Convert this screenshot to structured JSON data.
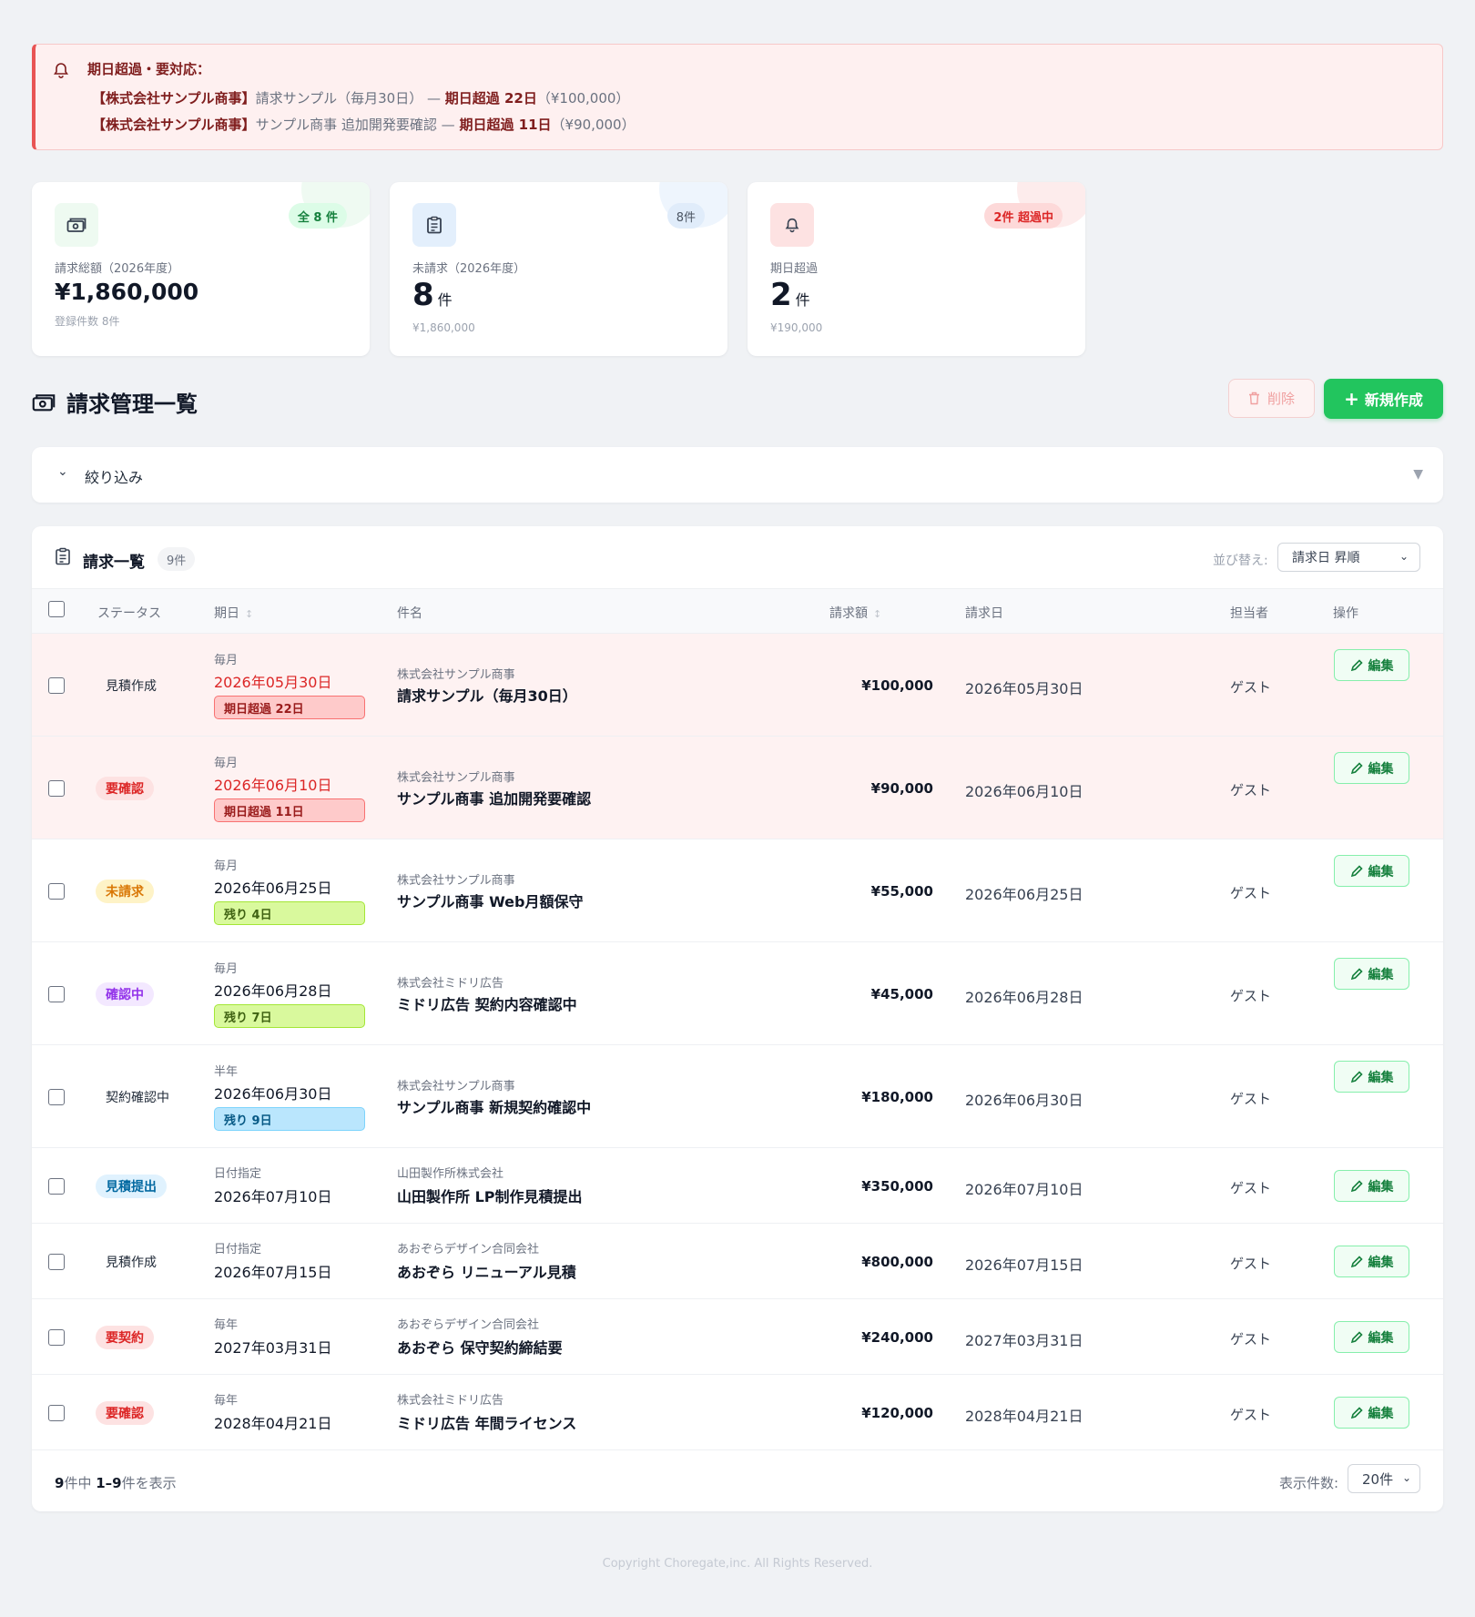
{
  "alert": {
    "title": "期日超過・要対応：",
    "items": [
      {
        "company": "【株式会社サンプル商事】",
        "subject": "請求サンプル（毎月30日）",
        "sep": " — ",
        "overdue": "期日超過 22日",
        "amount": "（¥100,000）"
      },
      {
        "company": "【株式会社サンプル商事】",
        "subject": "サンプル商事 追加開発要確認",
        "sep": " — ",
        "overdue": "期日超過 11日",
        "amount": "（¥90,000）"
      }
    ]
  },
  "cards": [
    {
      "badge": "全 8 件",
      "label": "請求総額（2026年度）",
      "value": "¥1,860,000",
      "unit": "",
      "sub": "登録件数 8件",
      "accent": "#22c55e",
      "icon": "money-icon"
    },
    {
      "badge": "8件",
      "label": "未請求（2026年度）",
      "value": "8",
      "unit": "件",
      "sub": "¥1,860,000",
      "accent": "#3b82f6",
      "icon": "clipboard-icon"
    },
    {
      "badge": "2件 超過中",
      "label": "期日超過",
      "value": "2",
      "unit": "件",
      "sub": "¥190,000",
      "accent": "#ef4444",
      "icon": "bell-icon"
    }
  ],
  "page": {
    "title": "請求管理一覧",
    "delete_label": "削除",
    "new_label": "新規作成"
  },
  "filter": {
    "label": "絞り込み"
  },
  "list": {
    "title": "請求一覧",
    "count": "9件",
    "sort_label": "並び替え:",
    "sort_value": "請求日 昇順",
    "columns": {
      "status": "ステータス",
      "due": "期日",
      "subject": "件名",
      "amount": "請求額",
      "billing_date": "請求日",
      "owner": "担当者",
      "actions": "操作"
    },
    "edit_label": "編集",
    "rows": [
      {
        "status": "見積作成",
        "cycle": "毎月",
        "due": "2026年05月30日",
        "chip": "期日超過 22日",
        "company": "株式会社サンプル商事",
        "subject": "請求サンプル（毎月30日）",
        "amount": "¥100,000",
        "billing_date": "2026年05月30日",
        "owner": "ゲスト"
      },
      {
        "status": "要確認",
        "cycle": "毎月",
        "due": "2026年06月10日",
        "chip": "期日超過 11日",
        "company": "株式会社サンプル商事",
        "subject": "サンプル商事 追加開発要確認",
        "amount": "¥90,000",
        "billing_date": "2026年06月10日",
        "owner": "ゲスト"
      },
      {
        "status": "未請求",
        "cycle": "毎月",
        "due": "2026年06月25日",
        "chip": "残り 4日",
        "company": "株式会社サンプル商事",
        "subject": "サンプル商事 Web月額保守",
        "amount": "¥55,000",
        "billing_date": "2026年06月25日",
        "owner": "ゲスト"
      },
      {
        "status": "確認中",
        "cycle": "毎月",
        "due": "2026年06月28日",
        "chip": "残り 7日",
        "company": "株式会社ミドリ広告",
        "subject": "ミドリ広告 契約内容確認中",
        "amount": "¥45,000",
        "billing_date": "2026年06月28日",
        "owner": "ゲスト"
      },
      {
        "status": "契約確認中",
        "cycle": "半年",
        "due": "2026年06月30日",
        "chip": "残り 9日",
        "company": "株式会社サンプル商事",
        "subject": "サンプル商事 新規契約確認中",
        "amount": "¥180,000",
        "billing_date": "2026年06月30日",
        "owner": "ゲスト"
      },
      {
        "status": "見積提出",
        "cycle": "日付指定",
        "due": "2026年07月10日",
        "company": "山田製作所株式会社",
        "subject": "山田製作所 LP制作見積提出",
        "amount": "¥350,000",
        "billing_date": "2026年07月10日",
        "owner": "ゲスト"
      },
      {
        "status": "見積作成",
        "cycle": "日付指定",
        "due": "2026年07月15日",
        "company": "あおぞらデザイン合同会社",
        "subject": "あおぞら リニューアル見積",
        "amount": "¥800,000",
        "billing_date": "2026年07月15日",
        "owner": "ゲスト"
      },
      {
        "status": "要契約",
        "cycle": "毎年",
        "due": "2027年03月31日",
        "company": "あおぞらデザイン合同会社",
        "subject": "あおぞら 保守契約締結要",
        "amount": "¥240,000",
        "billing_date": "2027年03月31日",
        "owner": "ゲスト"
      },
      {
        "status": "要確認",
        "cycle": "毎年",
        "due": "2028年04月21日",
        "company": "株式会社ミドリ広告",
        "subject": "ミドリ広告 年間ライセンス",
        "amount": "¥120,000",
        "billing_date": "2028年04月21日",
        "owner": "ゲスト"
      }
    ],
    "footer": {
      "total": "9",
      "mid": "件中 ",
      "range": "1–9",
      "tail": "件を表示",
      "per_page_label": "表示件数:",
      "per_page": "20件"
    }
  },
  "copyright": "Copyright Choregate,inc. All Rights Reserved."
}
